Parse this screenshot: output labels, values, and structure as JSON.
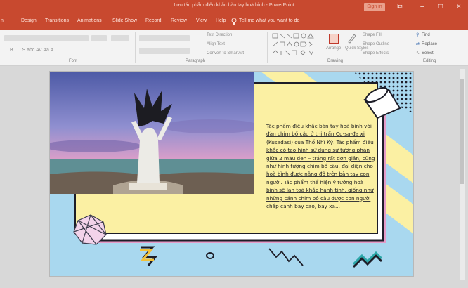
{
  "window": {
    "title": "Lưu tác phẩm điêu khắc bàn tay hoà bình - PowerPoint",
    "sign_in": "Sign in",
    "controls": {
      "restore": "⧉",
      "minimize": "–",
      "maximize": "□",
      "close": "×"
    }
  },
  "tabs": [
    {
      "label": "n"
    },
    {
      "label": "Design"
    },
    {
      "label": "Transitions"
    },
    {
      "label": "Animations"
    },
    {
      "label": "Slide Show"
    },
    {
      "label": "Record"
    },
    {
      "label": "Review"
    },
    {
      "label": "View"
    },
    {
      "label": "Help"
    }
  ],
  "tell_me": "Tell me what you want to do",
  "ribbon": {
    "groups": {
      "font": "Font",
      "paragraph": "Paragraph",
      "drawing": "Drawing",
      "editing": "Editing"
    },
    "paragraph": {
      "text_direction": "Text Direction",
      "align_text": "Align Text",
      "convert_smartart": "Convert to SmartArt"
    },
    "drawing": {
      "arrange": "Arrange",
      "quick_styles": "Quick Styles",
      "shape_fill": "Shape Fill",
      "shape_outline": "Shape Outline",
      "shape_effects": "Shape Effects"
    },
    "editing": {
      "find": "Find",
      "replace": "Replace",
      "select": "Select"
    }
  },
  "slide": {
    "body_text": "Tác phẩm điêu khắc bàn tay hoà bình với đàn chim bồ câu ở thị trấn Cu-sa-đa xi (Kusadasi) của Thổ Nhĩ Kỳ. Tác phẩm điêu khắc có tạo hình sử dụng sự tương phản giữa 2 màu đen – trắng rất đơn giản, cũng như hình tượng chim bồ câu, đại diện cho hoà bình được nâng đỡ trên bàn tay con người. Tác phẩm thể hiện ý tưởng hoà bình sẽ lan toả khắp hành tinh, giống như những cánh chim bồ câu được con người chắp cánh bay cao, bay xa..."
  },
  "colors": {
    "accent": "#c8492f",
    "slide_bg": "#a9d8ef",
    "frame_yellow": "#fbf0a3",
    "frame_pink": "#e69cc8"
  },
  "icons": {
    "restore": "restore-icon",
    "minimize": "minimize-icon",
    "maximize": "maximize-icon",
    "close": "close-icon",
    "lightbulb": "lightbulb-icon",
    "find": "magnifier-icon",
    "replace": "replace-icon",
    "select": "cursor-icon"
  }
}
